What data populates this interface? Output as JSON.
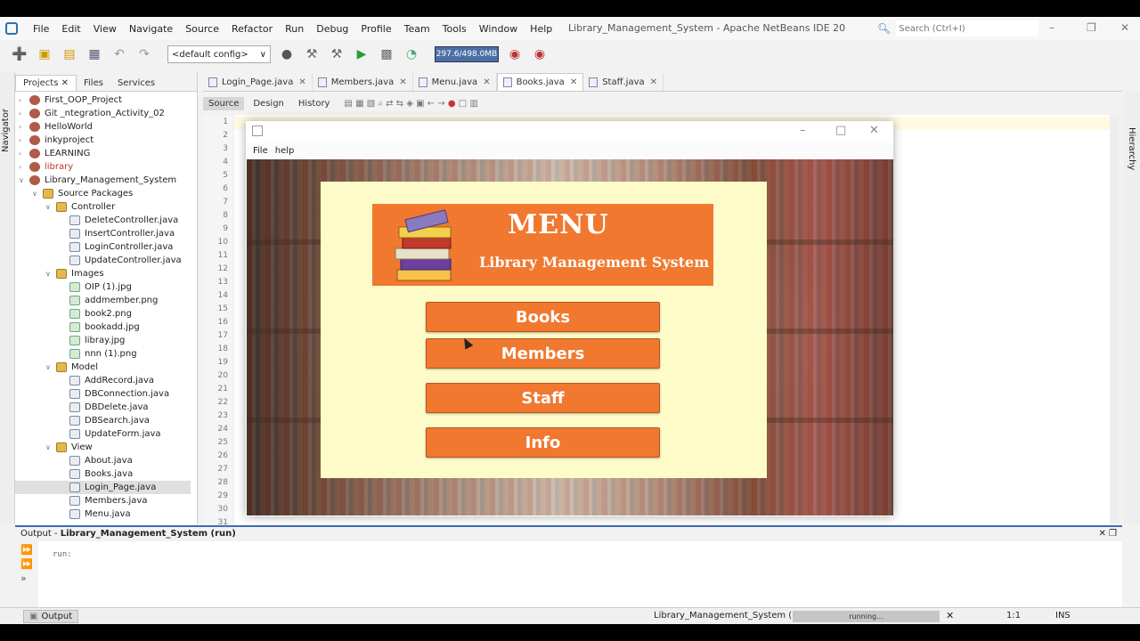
{
  "menubar": {
    "items": [
      "File",
      "Edit",
      "View",
      "Navigate",
      "Source",
      "Refactor",
      "Run",
      "Debug",
      "Profile",
      "Team",
      "Tools",
      "Window",
      "Help"
    ],
    "title": "Library_Management_System - Apache NetBeans IDE 20",
    "search_placeholder": "Search (Ctrl+I)"
  },
  "toolbar": {
    "config": "<default config>",
    "memory": "297.6/498.0MB"
  },
  "navigator_label": "Navigator",
  "hierarchy_label": "Hierarchy",
  "panel_tabs": [
    "Projects",
    "Files",
    "Services"
  ],
  "tree": [
    {
      "label": "First_OOP_Project",
      "type": "proj",
      "depth": 0
    },
    {
      "label": "Git _ntegration_Activity_02",
      "type": "proj",
      "depth": 0
    },
    {
      "label": "HelloWorld",
      "type": "proj",
      "depth": 0
    },
    {
      "label": "inkyproject",
      "type": "proj",
      "depth": 0
    },
    {
      "label": "LEARNING",
      "type": "proj",
      "depth": 0
    },
    {
      "label": "library",
      "type": "proj",
      "depth": 0,
      "color": "#c0392b"
    },
    {
      "label": "Library_Management_System",
      "type": "proj",
      "depth": 0
    },
    {
      "label": "Source Packages",
      "type": "pkg",
      "depth": 1
    },
    {
      "label": "Controller",
      "type": "pkg",
      "depth": 2
    },
    {
      "label": "DeleteController.java",
      "type": "java",
      "depth": 3
    },
    {
      "label": "InsertController.java",
      "type": "java",
      "depth": 3
    },
    {
      "label": "LoginController.java",
      "type": "java",
      "depth": 3
    },
    {
      "label": "UpdateController.java",
      "type": "java",
      "depth": 3
    },
    {
      "label": "Images",
      "type": "pkg",
      "depth": 2
    },
    {
      "label": "OIP (1).jpg",
      "type": "img",
      "depth": 3
    },
    {
      "label": "addmember.png",
      "type": "img",
      "depth": 3
    },
    {
      "label": "book2.png",
      "type": "img",
      "depth": 3
    },
    {
      "label": "bookadd.jpg",
      "type": "img",
      "depth": 3
    },
    {
      "label": "libray.jpg",
      "type": "img",
      "depth": 3
    },
    {
      "label": "nnn (1).png",
      "type": "img",
      "depth": 3
    },
    {
      "label": "Model",
      "type": "pkg",
      "depth": 2
    },
    {
      "label": "AddRecord.java",
      "type": "java",
      "depth": 3
    },
    {
      "label": "DBConnection.java",
      "type": "java",
      "depth": 3
    },
    {
      "label": "DBDelete.java",
      "type": "java",
      "depth": 3
    },
    {
      "label": "DBSearch.java",
      "type": "java",
      "depth": 3
    },
    {
      "label": "UpdateForm.java",
      "type": "java",
      "depth": 3
    },
    {
      "label": "View",
      "type": "pkg",
      "depth": 2
    },
    {
      "label": "About.java",
      "type": "java",
      "depth": 3
    },
    {
      "label": "Books.java",
      "type": "java",
      "depth": 3
    },
    {
      "label": "Login_Page.java",
      "type": "java",
      "depth": 3,
      "selected": true
    },
    {
      "label": "Members.java",
      "type": "java",
      "depth": 3
    },
    {
      "label": "Menu.java",
      "type": "java",
      "depth": 3
    }
  ],
  "editor_tabs": [
    {
      "label": "Login_Page.java",
      "active": false
    },
    {
      "label": "Members.java",
      "active": false
    },
    {
      "label": "Menu.java",
      "active": false
    },
    {
      "label": "Books.java",
      "active": true
    },
    {
      "label": "Staff.java",
      "active": false
    }
  ],
  "editor_modes": [
    "Source",
    "Design",
    "History"
  ],
  "line_numbers": [
    "1",
    "2",
    "3",
    "4",
    "5",
    "6",
    "7",
    "8",
    "9",
    "10",
    "11",
    "12",
    "13",
    "14",
    "15",
    "16",
    "17",
    "18",
    "19",
    "20",
    "21",
    "22",
    "23",
    "24",
    "25",
    "26",
    "27",
    "28",
    "29",
    "30",
    "31"
  ],
  "output": {
    "title_prefix": "Output - ",
    "title_bold": "Library_Management_System (run)",
    "text": "run:"
  },
  "status": {
    "output_tab": "Output",
    "project": "Library_Management_System (run)",
    "progress_label": "running...",
    "position": "1:1",
    "mode": "INS"
  },
  "app": {
    "menu_items": [
      "File",
      "help"
    ],
    "banner_title": "MENU",
    "banner_subtitle": "Library Management System",
    "buttons": [
      "Books",
      "Members",
      "Staff",
      "Info"
    ],
    "accent": "#f0782f",
    "panel_bg": "#fdfcc9"
  }
}
